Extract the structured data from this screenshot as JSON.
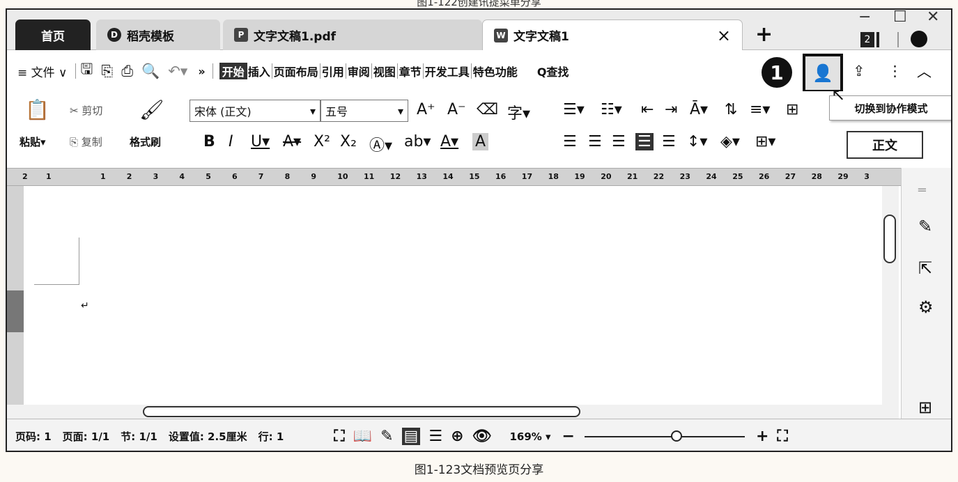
{
  "top_caption": "图1-122创建讯提菜单分享",
  "tabs": {
    "home": "首页",
    "daoke": "稻壳模板",
    "pdf": "文字文稿1.pdf",
    "doc": "文字文稿1",
    "doc_icon": "W",
    "pdf_icon": "P",
    "daoke_icon": "D",
    "close": "×",
    "new": "+"
  },
  "window": {
    "minimize": "−",
    "maximize": "☐",
    "close": "✕",
    "badge": "2"
  },
  "menu": {
    "file": "≡ 文件 ∨",
    "more": "»",
    "tabs": [
      "开始",
      "插入",
      "页面布局",
      "引用",
      "审阅",
      "视图",
      "章节",
      "开发工具",
      "特色功能"
    ],
    "search": "Q查找",
    "active": "开始"
  },
  "annotation": {
    "step": "1",
    "tooltip": "切换到协作模式"
  },
  "ribbon": {
    "paste": "粘贴▾",
    "cut": "剪切",
    "copy": "复制",
    "format_painter": "格式刷",
    "font": "宋体 (正文)",
    "size": "五号",
    "style": "正文"
  },
  "ruler_numbers": [
    "2",
    "1",
    "1",
    "2",
    "3",
    "4",
    "5",
    "6",
    "7",
    "8",
    "9",
    "10",
    "11",
    "12",
    "13",
    "14",
    "15",
    "16",
    "17",
    "18",
    "19",
    "20",
    "21",
    "22",
    "23",
    "24",
    "25",
    "26",
    "27",
    "28",
    "29",
    "3"
  ],
  "status": {
    "page": "页码: 1",
    "pages": "页面: 1/1",
    "section": "节: 1/1",
    "setting": "设置值: 2.5厘米",
    "row": "行: 1",
    "zoom": "169% ▾",
    "minus": "−",
    "plus": "+"
  },
  "bottom_caption": "图1-123文档预览页分享"
}
